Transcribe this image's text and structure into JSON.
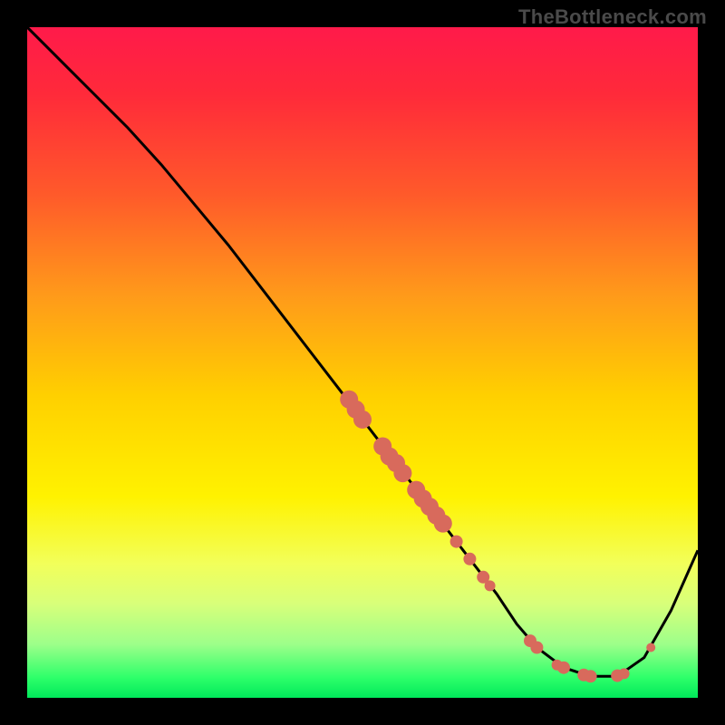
{
  "watermark": "TheBottleneck.com",
  "chart_data": {
    "type": "line",
    "title": "",
    "xlabel": "",
    "ylabel": "",
    "xlim": [
      0,
      100
    ],
    "ylim": [
      0,
      100
    ],
    "grid": false,
    "legend": false,
    "series": [
      {
        "name": "curve",
        "x": [
          0,
          3,
          6,
          10,
          15,
          20,
          25,
          30,
          35,
          40,
          45,
          50,
          55,
          60,
          65,
          70,
          73,
          76,
          80,
          84,
          88,
          92,
          96,
          100
        ],
        "y": [
          100,
          97,
          94,
          90,
          85,
          79.5,
          73.5,
          67.5,
          61,
          54.5,
          48,
          41.5,
          35,
          28.5,
          22,
          15.5,
          11,
          7.5,
          4.5,
          3.2,
          3.2,
          6,
          13,
          22
        ],
        "stroke": "#000000",
        "stroke_width": 3
      }
    ],
    "scatter_points": {
      "name": "marked-points",
      "color": "#d86a5c",
      "radius_major": 10,
      "radius_minor": 5,
      "points": [
        {
          "x": 48,
          "y": 44.5,
          "r": 10
        },
        {
          "x": 49,
          "y": 43.0,
          "r": 10
        },
        {
          "x": 50,
          "y": 41.5,
          "r": 10
        },
        {
          "x": 53,
          "y": 37.5,
          "r": 10
        },
        {
          "x": 54,
          "y": 36.0,
          "r": 10
        },
        {
          "x": 55,
          "y": 35.0,
          "r": 10
        },
        {
          "x": 56,
          "y": 33.5,
          "r": 10
        },
        {
          "x": 58,
          "y": 31.0,
          "r": 10
        },
        {
          "x": 59,
          "y": 29.7,
          "r": 10
        },
        {
          "x": 60,
          "y": 28.5,
          "r": 10
        },
        {
          "x": 61,
          "y": 27.2,
          "r": 10
        },
        {
          "x": 62,
          "y": 26.0,
          "r": 10
        },
        {
          "x": 64,
          "y": 23.3,
          "r": 7
        },
        {
          "x": 66,
          "y": 20.7,
          "r": 7
        },
        {
          "x": 68,
          "y": 18.0,
          "r": 7
        },
        {
          "x": 69,
          "y": 16.7,
          "r": 6
        },
        {
          "x": 75,
          "y": 8.5,
          "r": 7
        },
        {
          "x": 76,
          "y": 7.5,
          "r": 7
        },
        {
          "x": 79,
          "y": 4.9,
          "r": 6
        },
        {
          "x": 80,
          "y": 4.5,
          "r": 7
        },
        {
          "x": 83,
          "y": 3.4,
          "r": 7
        },
        {
          "x": 84,
          "y": 3.2,
          "r": 7
        },
        {
          "x": 88,
          "y": 3.3,
          "r": 7
        },
        {
          "x": 89,
          "y": 3.6,
          "r": 6
        },
        {
          "x": 93,
          "y": 7.5,
          "r": 5
        }
      ]
    }
  }
}
